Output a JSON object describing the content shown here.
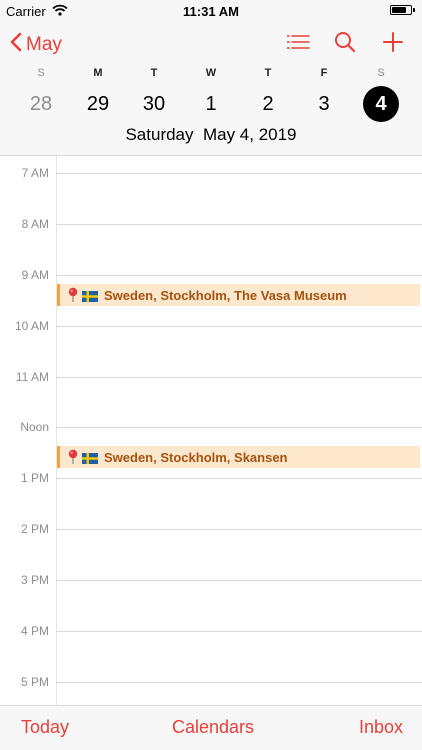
{
  "status_bar": {
    "carrier": "Carrier",
    "time": "11:31 AM"
  },
  "header": {
    "back_label": "May",
    "weekdays": [
      "S",
      "M",
      "T",
      "W",
      "T",
      "F",
      "S"
    ],
    "dates": [
      "28",
      "29",
      "30",
      "1",
      "2",
      "3",
      "4"
    ],
    "selected_date_index": 6,
    "full_date": "Saturday  May 4, 2019"
  },
  "timeline": {
    "hours": [
      "7 AM",
      "8 AM",
      "9 AM",
      "10 AM",
      "11 AM",
      "Noon",
      "1 PM",
      "2 PM",
      "3 PM",
      "4 PM",
      "5 PM"
    ]
  },
  "events": [
    {
      "title": "Sweden, Stockholm, The Vasa Museum"
    },
    {
      "title": "Sweden, Stockholm, Skansen"
    }
  ],
  "tabbar": {
    "today": "Today",
    "calendars": "Calendars",
    "inbox": "Inbox"
  },
  "colors": {
    "accent": "#e8403a",
    "event_bg": "#fde7cd",
    "event_bar": "#f0a43a",
    "event_text": "#a8520f"
  },
  "icons": [
    "wifi-icon",
    "battery-icon",
    "chevron-left-icon",
    "list-icon",
    "search-icon",
    "plus-icon",
    "pin-icon",
    "sweden-flag-icon"
  ]
}
